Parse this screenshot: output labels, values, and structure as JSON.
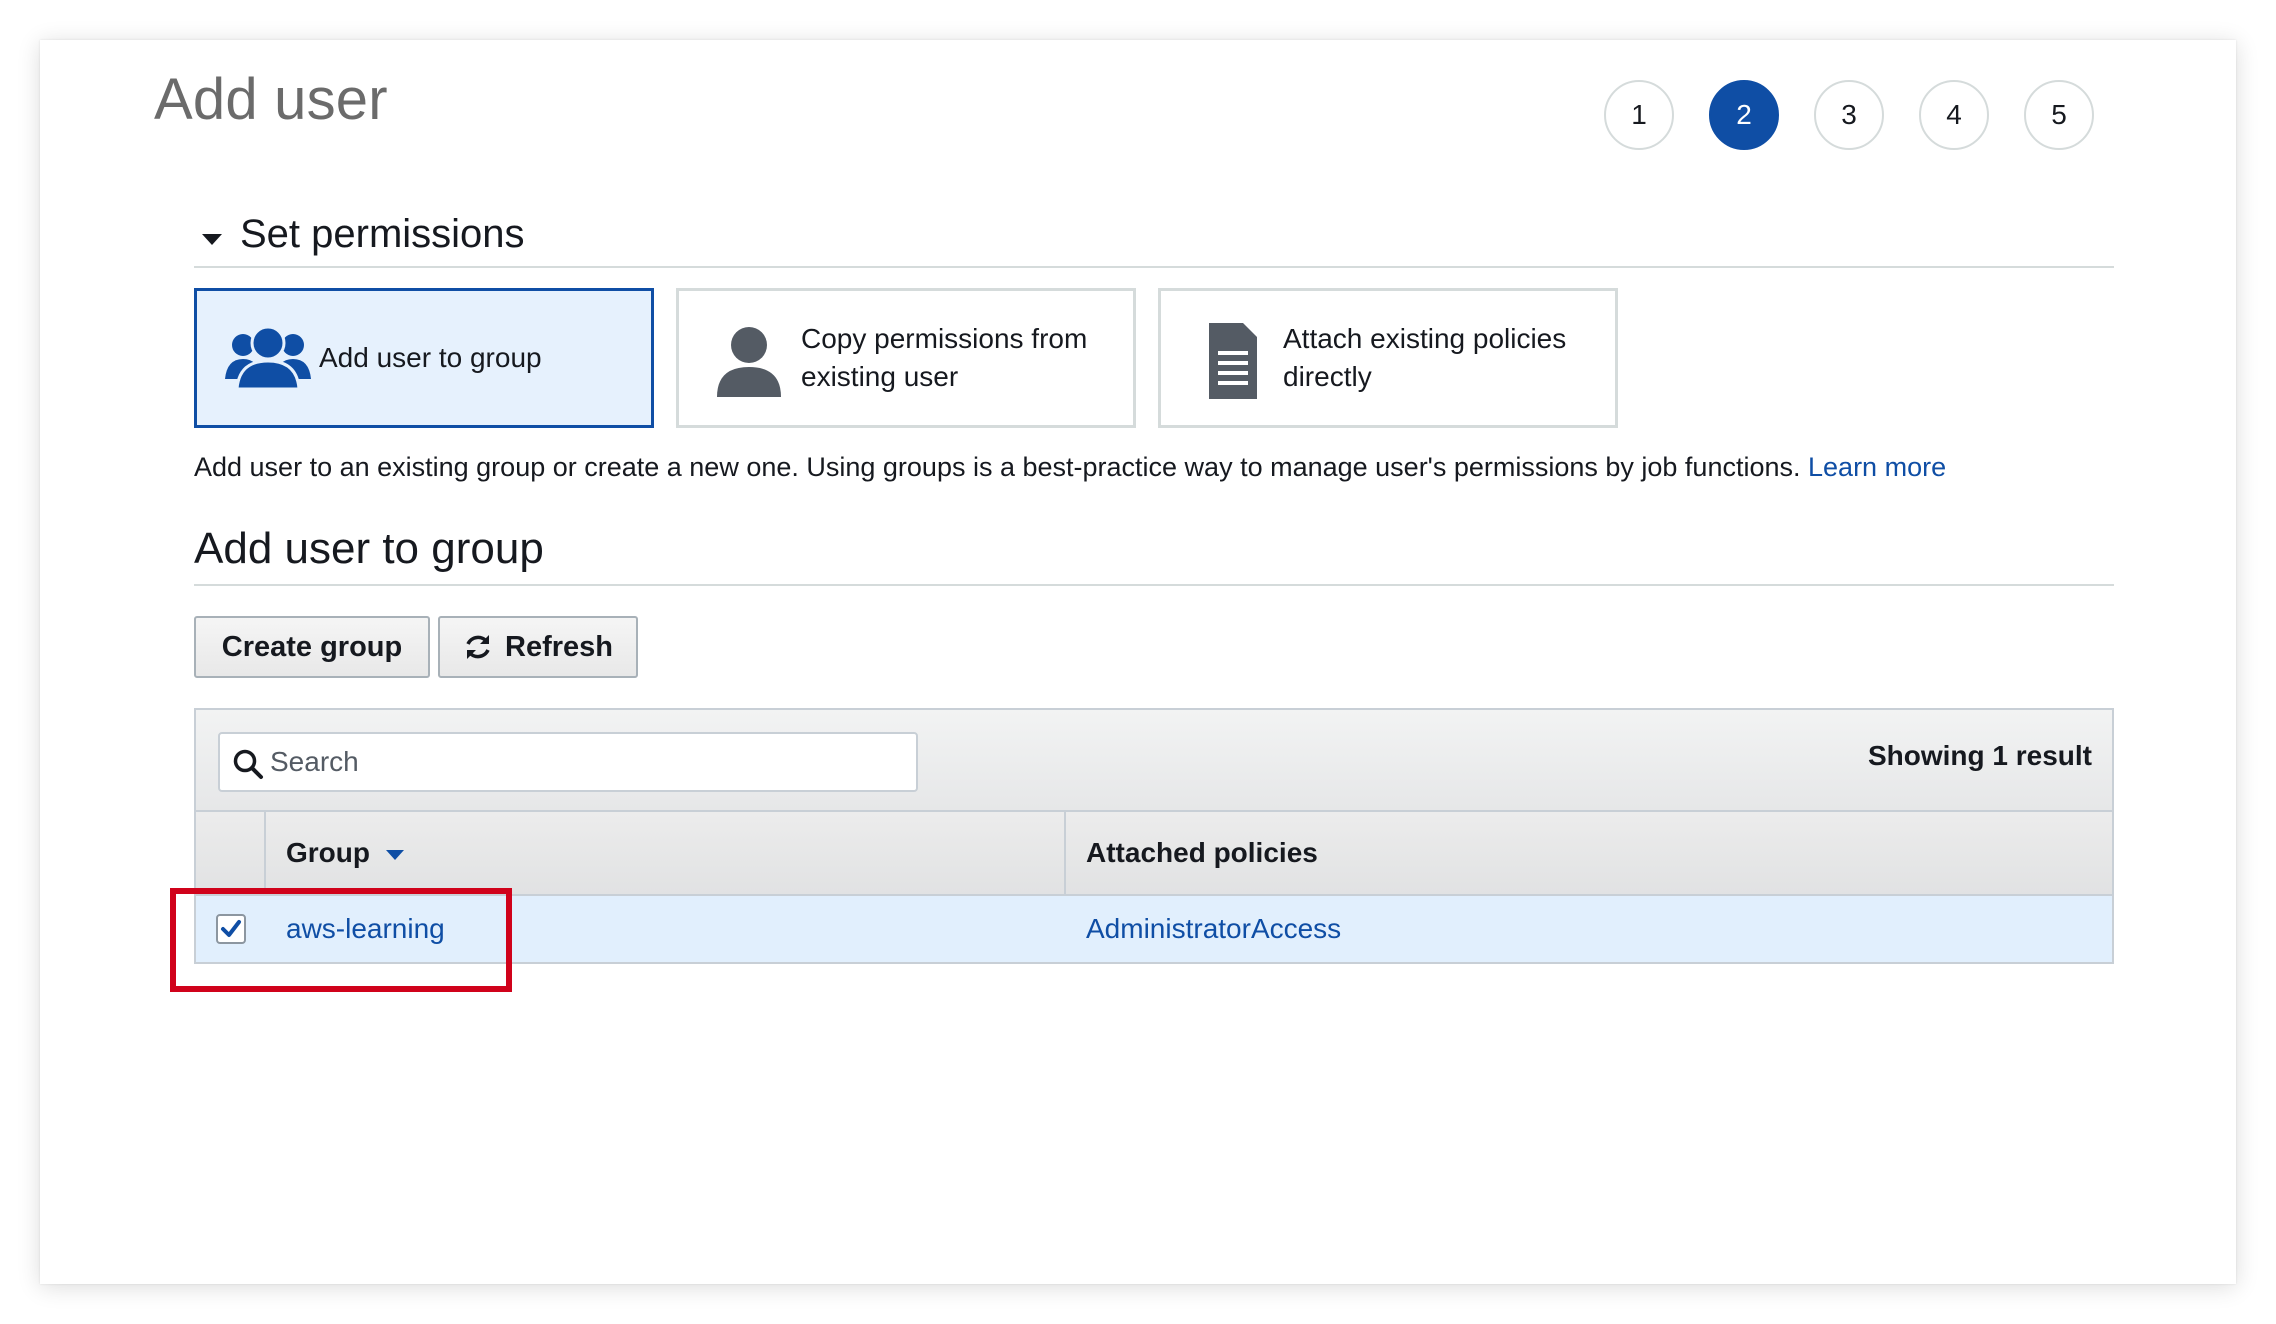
{
  "page": {
    "title": "Add user"
  },
  "steps": [
    "1",
    "2",
    "3",
    "4",
    "5"
  ],
  "active_step": "2",
  "section": {
    "title": "Set permissions"
  },
  "options": [
    {
      "label": "Add user to group",
      "icon": "group-icon",
      "selected": true
    },
    {
      "label": "Copy permissions from existing user",
      "icon": "user-icon",
      "selected": false
    },
    {
      "label": "Attach existing policies directly",
      "icon": "document-icon",
      "selected": false
    }
  ],
  "description": {
    "text": "Add user to an existing group or create a new one. Using groups is a best-practice way to manage user's permissions by job functions.",
    "link": "Learn more"
  },
  "group_section": {
    "title": "Add user to group"
  },
  "toolbar": {
    "create_label": "Create group",
    "refresh_label": "Refresh"
  },
  "table": {
    "search_placeholder": "Search",
    "showing": "Showing 1 result",
    "columns": [
      "Group",
      "Attached policies"
    ],
    "rows": [
      {
        "group": "aws-learning",
        "policies": "AdministratorAccess",
        "checked": true
      }
    ]
  },
  "colors": {
    "accent": "#0f4ea5",
    "selected_bg": "#e6f1fd",
    "highlight": "#d0021b"
  }
}
